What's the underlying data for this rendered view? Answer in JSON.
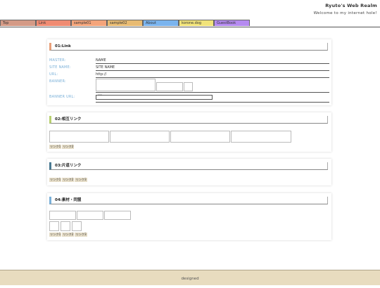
{
  "header": {
    "title": "Ryuto's Web Realm",
    "subtitle": "Welcome to my internet hole!"
  },
  "nav": {
    "tabs": [
      {
        "label": "Top",
        "color": "#d49a86"
      },
      {
        "label": "Link",
        "color": "#f08b72"
      },
      {
        "label": "sample01",
        "color": "#f4a47a"
      },
      {
        "label": "sample02",
        "color": "#e8bb72"
      },
      {
        "label": "About",
        "color": "#7ab4ee"
      },
      {
        "label": "korone.dog",
        "color": "#f1e37a"
      },
      {
        "label": "GuestBook",
        "color": "#b58af0"
      }
    ]
  },
  "sections": {
    "link": {
      "heading": "01:Link",
      "accent": "#e8a07a",
      "fields": [
        {
          "label": "MASTER:",
          "value": "NAME"
        },
        {
          "label": "SITE NAME:",
          "value": "SITE NAME"
        },
        {
          "label": "URL:",
          "value": "http://"
        },
        {
          "label": "BANNER:"
        },
        {
          "label": "BANNER URL:",
          "value": "\"\"\""
        }
      ]
    },
    "mutual": {
      "heading": "02:相互リンク",
      "accent": "#b8d070",
      "chips": [
        "リンク1",
        "リンク2"
      ]
    },
    "oneway": {
      "heading": "03:片道リンク",
      "accent": "#4a7a92",
      "chips": [
        "リンク1",
        "リンク2",
        "リンク3"
      ]
    },
    "materials": {
      "heading": "04:素材・同盟",
      "accent": "#7ab0d8",
      "chips": [
        "リンク1",
        "リンク2",
        "リンク3"
      ]
    }
  },
  "footer": {
    "text": "designed"
  }
}
